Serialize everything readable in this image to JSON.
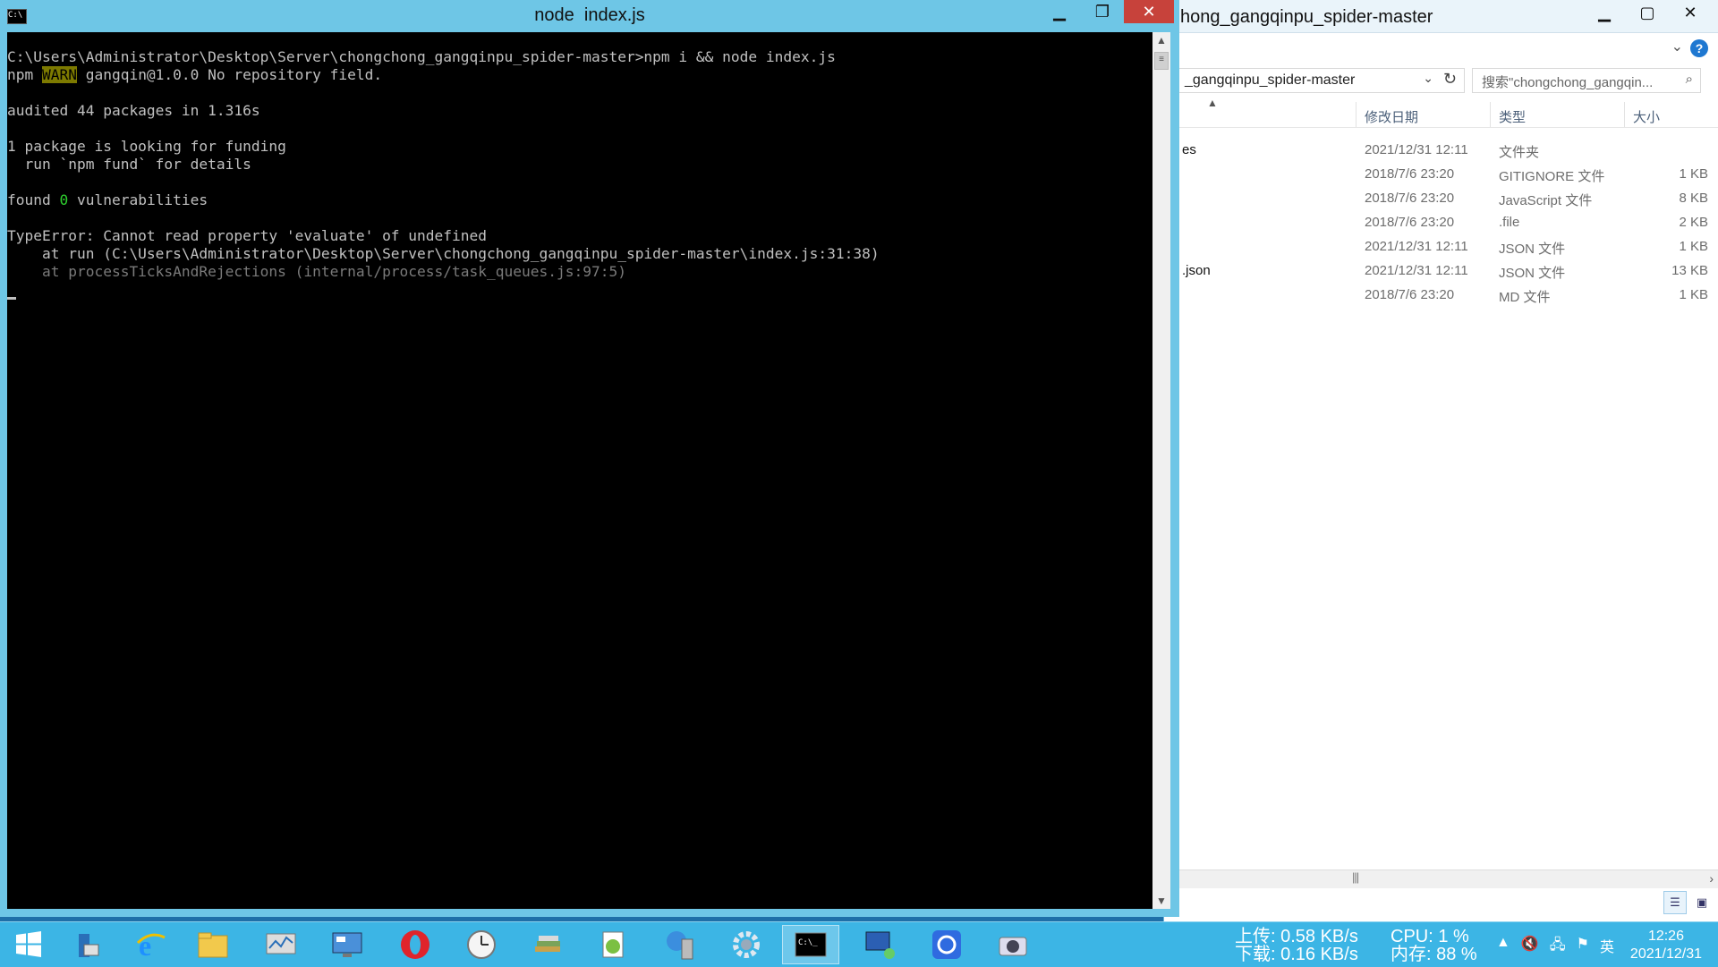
{
  "explorer": {
    "title": "hong_gangqinpu_spider-master",
    "address": "_gangqinpu_spider-master",
    "search_placeholder": "搜索\"chongchong_gangqin...",
    "columns": {
      "date": "修改日期",
      "type": "类型",
      "size": "大小"
    },
    "rows": [
      {
        "name": "es",
        "date": "2021/12/31 12:11",
        "type": "文件夹",
        "size": ""
      },
      {
        "name": "",
        "date": "2018/7/6 23:20",
        "type": "GITIGNORE 文件",
        "size": "1 KB"
      },
      {
        "name": "",
        "date": "2018/7/6 23:20",
        "type": "JavaScript 文件",
        "size": "8 KB"
      },
      {
        "name": "",
        "date": "2018/7/6 23:20",
        "type": ".file",
        "size": "2 KB"
      },
      {
        "name": "",
        "date": "2021/12/31 12:11",
        "type": "JSON 文件",
        "size": "1 KB"
      },
      {
        "name": ".json",
        "date": "2021/12/31 12:11",
        "type": "JSON 文件",
        "size": "13 KB"
      },
      {
        "name": "",
        "date": "2018/7/6 23:20",
        "type": "MD 文件",
        "size": "1 KB"
      }
    ]
  },
  "console": {
    "title": "node  index.js",
    "lines": [
      "C:\\Users\\Administrator\\Desktop\\Server\\chongchong_gangqinpu_spider-master>npm i && node index.js",
      "",
      "",
      "audited 44 packages in 1.316s",
      "",
      "1 package is looking for funding",
      "  run `npm fund` for details",
      "",
      "",
      "",
      "TypeError: Cannot read property 'evaluate' of undefined",
      "    at run (C:\\Users\\Administrator\\Desktop\\Server\\chongchong_gangqinpu_spider-master\\index.js:31:38)",
      "    at processTicksAndRejections (internal/process/task_queues.js:97:5)"
    ],
    "warn_line": {
      "prefix": "npm ",
      "tag": "WARN",
      "rest": " gangqin@1.0.0 No repository field."
    },
    "found_line": {
      "prefix": "found ",
      "count": "0",
      "rest": " vulnerabilities"
    }
  },
  "taskbar": {
    "upload": "上传: 0.58 KB/s",
    "download": "下载: 0.16 KB/s",
    "cpu": "CPU: 1 %",
    "mem": "内存: 88 %",
    "ime": "英",
    "time": "12:26",
    "date": "2021/12/31"
  }
}
